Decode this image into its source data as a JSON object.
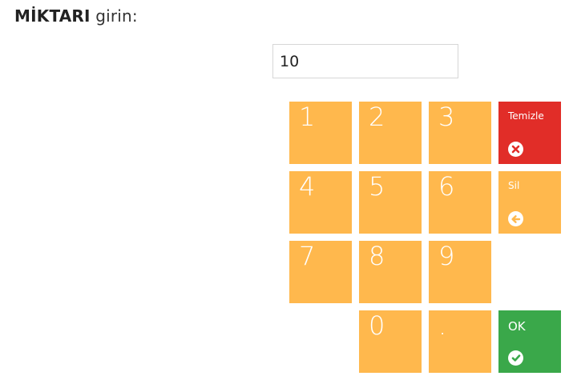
{
  "prompt": {
    "bold": "MİKTARI",
    "rest": " girin:"
  },
  "quantity": {
    "value": "10"
  },
  "keypad": {
    "keys": [
      "1",
      "2",
      "3",
      "4",
      "5",
      "6",
      "7",
      "8",
      "9",
      "0",
      "."
    ],
    "clear_label": "Temizle",
    "delete_label": "Sil",
    "ok_label": "OK"
  },
  "colors": {
    "key": "#ffb84d",
    "clear": "#e12d28",
    "ok": "#3aa84a"
  },
  "icons": {
    "clear": "close-circle-icon",
    "delete": "arrow-left-circle-icon",
    "ok": "check-circle-icon"
  }
}
